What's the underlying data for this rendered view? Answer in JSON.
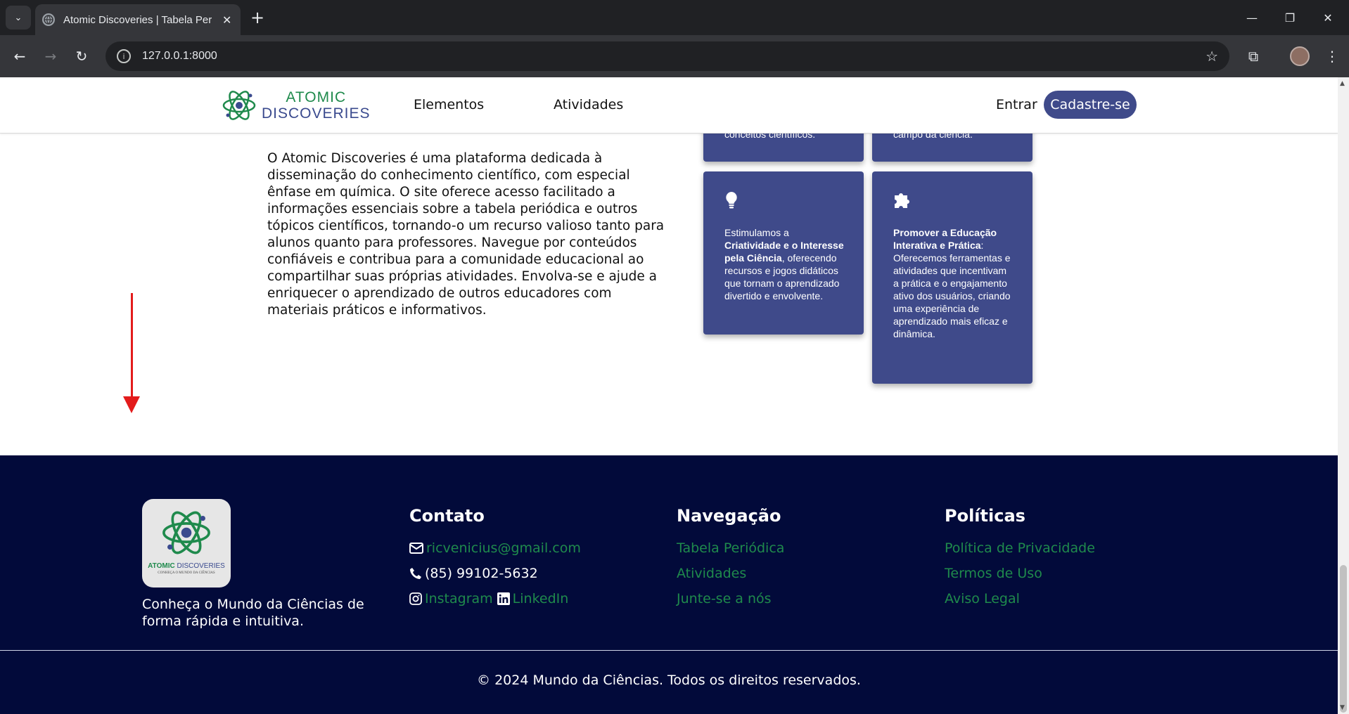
{
  "browser": {
    "tab_title": "Atomic Discoveries | Tabela Periódica",
    "url": "127.0.0.1:8000",
    "tab_close": "✕",
    "new_tab": "+",
    "win_min": "—",
    "win_restore": "❐",
    "win_close": "✕",
    "back": "←",
    "forward": "→",
    "reload": "↻",
    "bookmark": "☆",
    "extensions": "⧉",
    "menu": "⋮"
  },
  "header": {
    "logo_word1": "ATOMIC",
    "logo_word2": "DISCOVERIES",
    "nav_elementos": "Elementos",
    "nav_atividades": "Atividades",
    "login": "Entrar",
    "signup": "Cadastre-se"
  },
  "about": {
    "text": "O Atomic Discoveries é uma plataforma dedicada à disseminação do conhecimento científico, com especial ênfase em química. O site oferece acesso facilitado a informações essenciais sobre a tabela periódica e outros tópicos científicos, tornando-o um recurso valioso tanto para alunos quanto para professores. Navegue por conteúdos confiáveis e contribua para a comunidade educacional ao compartilhar suas próprias atividades. Envolva-se e ajude a enriquecer o aprendizado de outros educadores com materiais práticos e informativos."
  },
  "cards": {
    "top1_text": "conceitos científicos.",
    "top2_text": "campo da ciência.",
    "c3_pre": "Estimulamos a ",
    "c3_bold": "Criatividade e o Interesse pela Ciência",
    "c3_post": ", oferecendo recursos e jogos didáticos que tornam o aprendizado divertido e envolvente.",
    "c4_bold": "Promover a Educação Interativa e Prática",
    "c4_post": ": Oferecemos ferramentas e atividades que incentivam a prática e o engajamento ativo dos usuários, criando uma experiência de aprendizado mais eficaz e dinâmica.",
    "icon_c3": "lightbulb-icon",
    "icon_c4": "puzzle-icon"
  },
  "footer": {
    "logo_word1": "ATOMIC",
    "logo_word2": "DISCOVERIES",
    "logo_tagline": "CONHEÇA O MUNDO DA CIÊNCIAS",
    "tagline": "Conheça o Mundo da Ciências de forma rápida e intuitiva.",
    "contato": {
      "title": "Contato",
      "email": "ricvenicius@gmail.com",
      "phone": "(85) 99102-5632",
      "instagram": "Instagram",
      "linkedin": "LinkedIn"
    },
    "navegacao": {
      "title": "Navegação",
      "items": [
        "Tabela Periódica",
        "Atividades",
        "Junte-se a nós"
      ]
    },
    "politicas": {
      "title": "Políticas",
      "items": [
        "Política de Privacidade",
        "Termos de Uso",
        "Aviso Legal"
      ]
    },
    "copyright": "© 2024 Mundo da Ciências. Todos os direitos reservados."
  },
  "colors": {
    "brand_blue": "#3f4a8a",
    "brand_green": "#1f8a4c",
    "footer_bg": "#020a3a",
    "annotation_arrow": "#e31b1b"
  }
}
